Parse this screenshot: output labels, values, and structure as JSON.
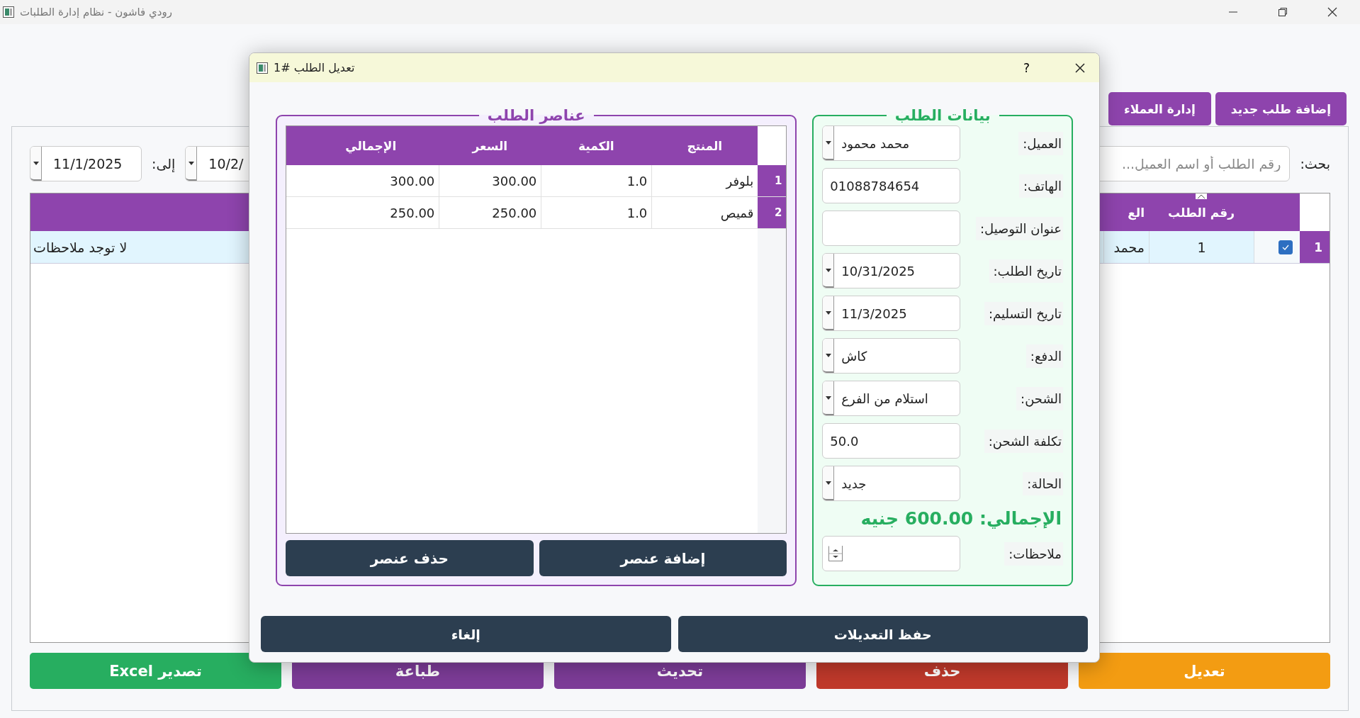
{
  "window": {
    "title": "رودي فاشون - نظام إدارة الطلبات"
  },
  "toolbar": {
    "buttons": [
      "إضافة طلب جديد",
      "إدارة العملاء"
    ]
  },
  "filters": {
    "search_label": "بحث:",
    "search_placeholder": "رقم الطلب أو اسم العميل...",
    "from_date": "10/2/",
    "to_label": "إلى:",
    "to_date": "11/1/2025"
  },
  "orders_table": {
    "columns": [
      {
        "label": "رقم الطلب",
        "sorted": true
      },
      {
        "label": "الع",
        "sorted": false
      }
    ],
    "rows": [
      {
        "number": "1",
        "checked": true,
        "order_no": "1",
        "customer": "محمد",
        "notes": "لا توجد ملاحظات"
      }
    ]
  },
  "actions": [
    {
      "label": "تعديل",
      "kind": "edit"
    },
    {
      "label": "حذف",
      "kind": "delete"
    },
    {
      "label": "تحديث",
      "kind": "refresh"
    },
    {
      "label": "طباعة",
      "kind": "print"
    },
    {
      "label": "تصدير Excel",
      "kind": "export"
    }
  ],
  "dialog": {
    "title": "تعديل الطلب #1",
    "help": "?",
    "order_group": {
      "title": "بيانات الطلب",
      "fields": [
        {
          "label": "العميل:",
          "kind": "combo",
          "value": "محمد محمود"
        },
        {
          "label": "الهاتف:",
          "kind": "text",
          "value": "01088784654"
        },
        {
          "label": "عنوان التوصيل:",
          "kind": "text"
        },
        {
          "label": "تاريخ الطلب:",
          "kind": "combo",
          "value": "10/31/2025"
        },
        {
          "label": "تاريخ التسليم:",
          "kind": "combo",
          "value": "11/3/2025"
        },
        {
          "label": "الدفع:",
          "kind": "combo",
          "value": "كاش"
        },
        {
          "label": "الشحن:",
          "kind": "combo",
          "value": "استلام من الفرع"
        },
        {
          "label": "تكلفة الشحن:",
          "kind": "text",
          "value": "50.0"
        },
        {
          "label": "الحالة:",
          "kind": "combo",
          "value": "جديد"
        }
      ],
      "total": "الإجمالي: 600.00 جنيه",
      "notes": {
        "label": "ملاحظات:",
        "kind": "spin"
      }
    },
    "items_group": {
      "title": "عناصر الطلب",
      "columns": [
        "المنتج",
        "الكمية",
        "السعر",
        "الإجمالي"
      ],
      "rows": [
        {
          "number": "1",
          "cells": [
            "بلوفر",
            "1.0",
            "300.00",
            "300.00"
          ]
        },
        {
          "number": "2",
          "cells": [
            "قميص",
            "1.0",
            "250.00",
            "250.00"
          ]
        }
      ],
      "buttons": [
        "إضافة عنصر",
        "حذف عنصر"
      ]
    },
    "buttons": [
      "حفظ التعديلات",
      "إلغاء"
    ]
  }
}
